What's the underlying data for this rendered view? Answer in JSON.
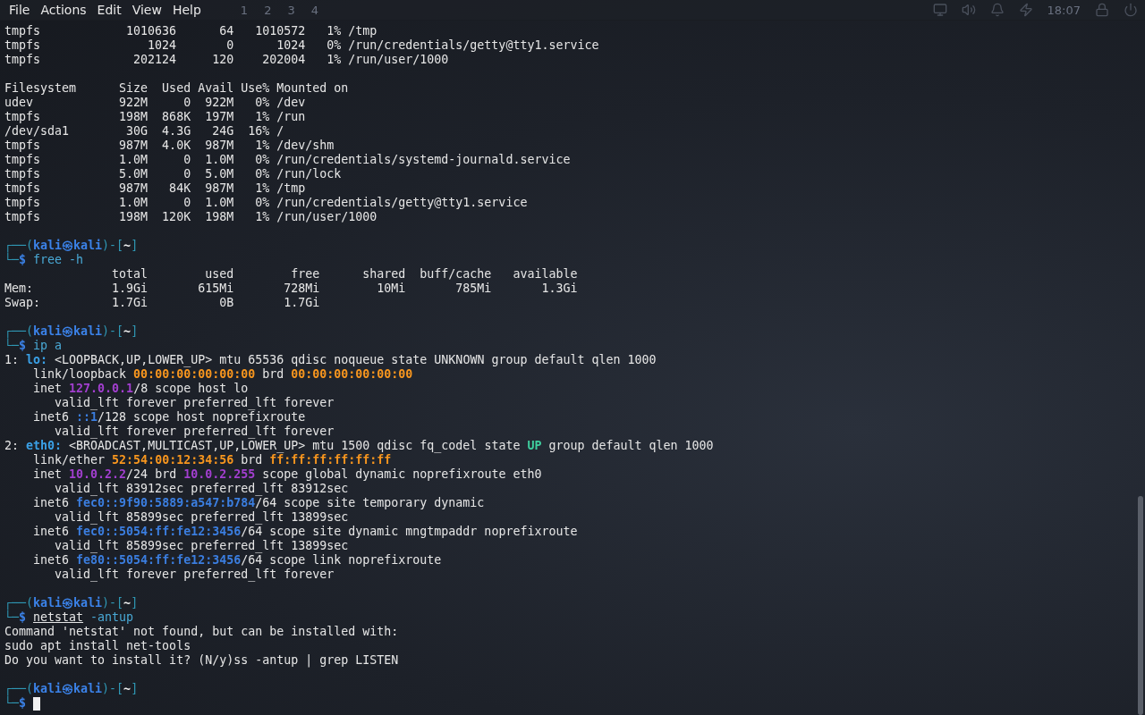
{
  "menu": [
    "File",
    "Actions",
    "Edit",
    "View",
    "Help"
  ],
  "panel": {
    "workspaces": [
      "1",
      "2",
      "3",
      "4"
    ],
    "clock": "18:07"
  },
  "terminal": {
    "cursor_visible": true,
    "lines": [
      {
        "kind": "text",
        "segs": [
          {
            "text": "tmpfs            1010636      64   1010572   1% /tmp",
            "kind": "plain"
          }
        ]
      },
      {
        "kind": "text",
        "segs": [
          {
            "text": "tmpfs               1024       0      1024   0% /run/credentials/getty@tty1.service",
            "kind": "plain"
          }
        ]
      },
      {
        "kind": "text",
        "segs": [
          {
            "text": "tmpfs             202124     120    202004   1% /run/user/1000",
            "kind": "plain"
          }
        ]
      },
      {
        "kind": "blank"
      },
      {
        "kind": "text",
        "segs": [
          {
            "text": "Filesystem      Size  Used Avail Use% Mounted on",
            "kind": "plain"
          }
        ]
      },
      {
        "kind": "text",
        "segs": [
          {
            "text": "udev            922M     0  922M   0% /dev",
            "kind": "plain"
          }
        ]
      },
      {
        "kind": "text",
        "segs": [
          {
            "text": "tmpfs           198M  868K  197M   1% /run",
            "kind": "plain"
          }
        ]
      },
      {
        "kind": "text",
        "segs": [
          {
            "text": "/dev/sda1        30G  4.3G   24G  16% /",
            "kind": "plain"
          }
        ]
      },
      {
        "kind": "text",
        "segs": [
          {
            "text": "tmpfs           987M  4.0K  987M   1% /dev/shm",
            "kind": "plain"
          }
        ]
      },
      {
        "kind": "text",
        "segs": [
          {
            "text": "tmpfs           1.0M     0  1.0M   0% /run/credentials/systemd-journald.service",
            "kind": "plain"
          }
        ]
      },
      {
        "kind": "text",
        "segs": [
          {
            "text": "tmpfs           5.0M     0  5.0M   0% /run/lock",
            "kind": "plain"
          }
        ]
      },
      {
        "kind": "text",
        "segs": [
          {
            "text": "tmpfs           987M   84K  987M   1% /tmp",
            "kind": "plain"
          }
        ]
      },
      {
        "kind": "text",
        "segs": [
          {
            "text": "tmpfs           1.0M     0  1.0M   0% /run/credentials/getty@tty1.service",
            "kind": "plain"
          }
        ]
      },
      {
        "kind": "text",
        "segs": [
          {
            "text": "tmpfs           198M  120K  198M   1% /run/user/1000",
            "kind": "plain"
          }
        ]
      },
      {
        "kind": "blank"
      },
      {
        "kind": "prompt",
        "segs": [
          {
            "text": "┌──(",
            "kind": "frame"
          },
          {
            "text": "kali㉿kali",
            "kind": "user"
          },
          {
            "text": ")-[",
            "kind": "frame"
          },
          {
            "text": "~",
            "kind": "dir"
          },
          {
            "text": "]",
            "kind": "frame"
          }
        ]
      },
      {
        "kind": "prompt",
        "segs": [
          {
            "text": "└─",
            "kind": "frame"
          },
          {
            "text": "$ ",
            "kind": "user"
          },
          {
            "text": "free -h",
            "kind": "cmd"
          }
        ]
      },
      {
        "kind": "text",
        "segs": [
          {
            "text": "               total        used        free      shared  buff/cache   available",
            "kind": "plain"
          }
        ]
      },
      {
        "kind": "text",
        "segs": [
          {
            "text": "Mem:           1.9Gi       615Mi       728Mi        10Mi       785Mi       1.3Gi",
            "kind": "plain"
          }
        ]
      },
      {
        "kind": "text",
        "segs": [
          {
            "text": "Swap:          1.7Gi          0B       1.7Gi",
            "kind": "plain"
          }
        ]
      },
      {
        "kind": "blank"
      },
      {
        "kind": "prompt",
        "segs": [
          {
            "text": "┌──(",
            "kind": "frame"
          },
          {
            "text": "kali㉿kali",
            "kind": "user"
          },
          {
            "text": ")-[",
            "kind": "frame"
          },
          {
            "text": "~",
            "kind": "dir"
          },
          {
            "text": "]",
            "kind": "frame"
          }
        ]
      },
      {
        "kind": "prompt",
        "segs": [
          {
            "text": "└─",
            "kind": "frame"
          },
          {
            "text": "$ ",
            "kind": "user"
          },
          {
            "text": "ip a",
            "kind": "cmd"
          }
        ]
      },
      {
        "kind": "text",
        "segs": [
          {
            "text": "1: ",
            "kind": "plain"
          },
          {
            "text": "lo:",
            "kind": "iface"
          },
          {
            "text": " <LOOPBACK,UP,LOWER_UP> mtu 65536 qdisc noqueue state UNKNOWN group default qlen 1000",
            "kind": "plain"
          }
        ]
      },
      {
        "kind": "text",
        "segs": [
          {
            "text": "    link/loopback ",
            "kind": "plain"
          },
          {
            "text": "00:00:00:00:00:00",
            "kind": "mac"
          },
          {
            "text": " brd ",
            "kind": "plain"
          },
          {
            "text": "00:00:00:00:00:00",
            "kind": "mac"
          }
        ]
      },
      {
        "kind": "text",
        "segs": [
          {
            "text": "    inet ",
            "kind": "plain"
          },
          {
            "text": "127.0.0.1",
            "kind": "ipv4"
          },
          {
            "text": "/8 scope host lo",
            "kind": "plain"
          }
        ]
      },
      {
        "kind": "text",
        "segs": [
          {
            "text": "       valid_lft forever preferred_lft forever",
            "kind": "plain"
          }
        ]
      },
      {
        "kind": "text",
        "segs": [
          {
            "text": "    inet6 ",
            "kind": "plain"
          },
          {
            "text": "::1",
            "kind": "ipv6"
          },
          {
            "text": "/128 scope host noprefixroute",
            "kind": "plain"
          }
        ]
      },
      {
        "kind": "text",
        "segs": [
          {
            "text": "       valid_lft forever preferred_lft forever",
            "kind": "plain"
          }
        ]
      },
      {
        "kind": "text",
        "segs": [
          {
            "text": "2: ",
            "kind": "plain"
          },
          {
            "text": "eth0:",
            "kind": "iface"
          },
          {
            "text": " <BROADCAST,MULTICAST,UP,LOWER_UP> mtu 1500 qdisc fq_codel state ",
            "kind": "plain"
          },
          {
            "text": "UP",
            "kind": "up"
          },
          {
            "text": " group default qlen 1000",
            "kind": "plain"
          }
        ]
      },
      {
        "kind": "text",
        "segs": [
          {
            "text": "    link/ether ",
            "kind": "plain"
          },
          {
            "text": "52:54:00:12:34:56",
            "kind": "mac"
          },
          {
            "text": " brd ",
            "kind": "plain"
          },
          {
            "text": "ff:ff:ff:ff:ff:ff",
            "kind": "mac"
          }
        ]
      },
      {
        "kind": "text",
        "segs": [
          {
            "text": "    inet ",
            "kind": "plain"
          },
          {
            "text": "10.0.2.2",
            "kind": "ipv4"
          },
          {
            "text": "/24 brd ",
            "kind": "plain"
          },
          {
            "text": "10.0.2.255",
            "kind": "ipv4"
          },
          {
            "text": " scope global dynamic noprefixroute eth0",
            "kind": "plain"
          }
        ]
      },
      {
        "kind": "text",
        "segs": [
          {
            "text": "       valid_lft 83912sec preferred_lft 83912sec",
            "kind": "plain"
          }
        ]
      },
      {
        "kind": "text",
        "segs": [
          {
            "text": "    inet6 ",
            "kind": "plain"
          },
          {
            "text": "fec0::9f90:5889:a547:b784",
            "kind": "ipv6"
          },
          {
            "text": "/64 scope site temporary dynamic",
            "kind": "plain"
          }
        ]
      },
      {
        "kind": "text",
        "segs": [
          {
            "text": "       valid_lft 85899sec preferred_lft 13899sec",
            "kind": "plain"
          }
        ]
      },
      {
        "kind": "text",
        "segs": [
          {
            "text": "    inet6 ",
            "kind": "plain"
          },
          {
            "text": "fec0::5054:ff:fe12:3456",
            "kind": "ipv6"
          },
          {
            "text": "/64 scope site dynamic mngtmpaddr noprefixroute",
            "kind": "plain"
          }
        ]
      },
      {
        "kind": "text",
        "segs": [
          {
            "text": "       valid_lft 85899sec preferred_lft 13899sec",
            "kind": "plain"
          }
        ]
      },
      {
        "kind": "text",
        "segs": [
          {
            "text": "    inet6 ",
            "kind": "plain"
          },
          {
            "text": "fe80::5054:ff:fe12:3456",
            "kind": "ipv6"
          },
          {
            "text": "/64 scope link noprefixroute",
            "kind": "plain"
          }
        ]
      },
      {
        "kind": "text",
        "segs": [
          {
            "text": "       valid_lft forever preferred_lft forever",
            "kind": "plain"
          }
        ]
      },
      {
        "kind": "blank"
      },
      {
        "kind": "prompt",
        "segs": [
          {
            "text": "┌──(",
            "kind": "frame"
          },
          {
            "text": "kali㉿kali",
            "kind": "user"
          },
          {
            "text": ")-[",
            "kind": "frame"
          },
          {
            "text": "~",
            "kind": "dir"
          },
          {
            "text": "]",
            "kind": "frame"
          }
        ]
      },
      {
        "kind": "prompt",
        "segs": [
          {
            "text": "└─",
            "kind": "frame"
          },
          {
            "text": "$ ",
            "kind": "user"
          },
          {
            "text": "netstat",
            "kind": "missing"
          },
          {
            "text": " -antup",
            "kind": "cmd"
          }
        ]
      },
      {
        "kind": "text",
        "segs": [
          {
            "text": "Command 'netstat' not found, but can be installed with:",
            "kind": "plain"
          }
        ]
      },
      {
        "kind": "text",
        "segs": [
          {
            "text": "sudo apt install net-tools",
            "kind": "plain"
          }
        ]
      },
      {
        "kind": "text",
        "segs": [
          {
            "text": "Do you want to install it? (N/y)ss -antup | grep LISTEN",
            "kind": "plain"
          }
        ]
      },
      {
        "kind": "blank"
      },
      {
        "kind": "prompt",
        "segs": [
          {
            "text": "┌──(",
            "kind": "frame"
          },
          {
            "text": "kali㉿kali",
            "kind": "user"
          },
          {
            "text": ")-[",
            "kind": "frame"
          },
          {
            "text": "~",
            "kind": "dir"
          },
          {
            "text": "]",
            "kind": "frame"
          }
        ]
      },
      {
        "kind": "prompt",
        "segs": [
          {
            "text": "└─",
            "kind": "frame"
          },
          {
            "text": "$",
            "kind": "user"
          }
        ]
      }
    ]
  }
}
